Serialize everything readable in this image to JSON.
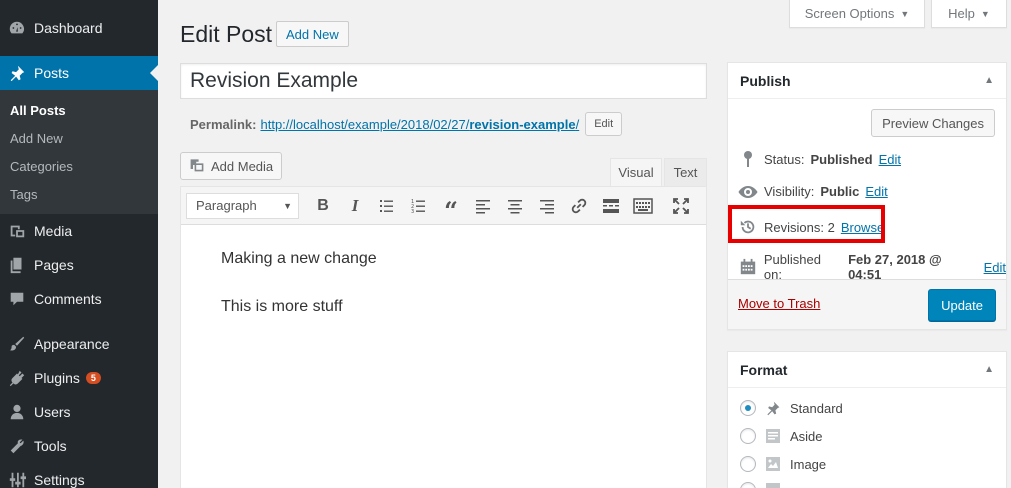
{
  "sidebar": {
    "items": [
      {
        "label": "Dashboard",
        "icon": "dashboard-icon"
      },
      {
        "label": "Posts",
        "icon": "pushpin-icon"
      },
      {
        "label": "Media",
        "icon": "media-icon"
      },
      {
        "label": "Pages",
        "icon": "pages-icon"
      },
      {
        "label": "Comments",
        "icon": "comments-icon"
      },
      {
        "label": "Appearance",
        "icon": "brush-icon"
      },
      {
        "label": "Plugins",
        "icon": "plugin-icon",
        "badge": "5"
      },
      {
        "label": "Users",
        "icon": "users-icon"
      },
      {
        "label": "Tools",
        "icon": "wrench-icon"
      },
      {
        "label": "Settings",
        "icon": "settings-icon"
      }
    ],
    "submenu": [
      "All Posts",
      "Add New",
      "Categories",
      "Tags"
    ]
  },
  "screen_options": "Screen Options",
  "help": "Help",
  "page_title": "Edit Post",
  "add_new": "Add New",
  "post_title": "Revision Example",
  "permalink": {
    "label": "Permalink:",
    "url_prefix": "http://localhost/example/2018/02/27/",
    "slug": "revision-example",
    "url_suffix": "/",
    "edit": "Edit"
  },
  "add_media": "Add Media",
  "tabs": {
    "visual": "Visual",
    "text": "Text"
  },
  "toolbar": {
    "format": "Paragraph"
  },
  "content": [
    "Making a new change",
    "This is more stuff"
  ],
  "publish": {
    "title": "Publish",
    "preview": "Preview Changes",
    "status_label": "Status:",
    "status_value": "Published",
    "visibility_label": "Visibility:",
    "visibility_value": "Public",
    "revisions_label": "Revisions:",
    "revisions_count": "2",
    "browse": "Browse",
    "published_on_label": "Published on:",
    "published_on_value": "Feb 27, 2018 @ 04:51",
    "edit": "Edit",
    "trash": "Move to Trash",
    "update": "Update"
  },
  "format": {
    "title": "Format",
    "options": [
      {
        "label": "Standard",
        "icon": "pushpin-icon",
        "checked": true
      },
      {
        "label": "Aside",
        "icon": "aside-icon",
        "checked": false
      },
      {
        "label": "Image",
        "icon": "image-icon",
        "checked": false
      }
    ]
  },
  "colors": {
    "accent": "#0073aa",
    "button": "#0085ba",
    "highlight": "#e80000",
    "badge": "#d54e21"
  }
}
